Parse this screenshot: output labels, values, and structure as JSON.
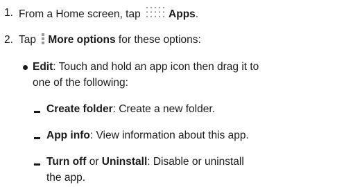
{
  "step1": {
    "number": "1.",
    "text_before": "From a Home screen, tap",
    "icon": "apps-grid-icon",
    "bold": "Apps",
    "text_after": "."
  },
  "step2": {
    "number": "2.",
    "text_before": "Tap",
    "icon": "more-options-vertical-dots-icon",
    "bold": "More options",
    "text_after": " for these options:"
  },
  "edit_item": {
    "bold": "Edit",
    "text_line1": ": Touch and hold an app icon then drag it to",
    "text_line2": "one of the following:"
  },
  "sub_items": [
    {
      "bold": "Create folder",
      "text": ": Create a new folder."
    },
    {
      "bold": "App info",
      "text": ": View information about this app."
    }
  ],
  "turn_off_item": {
    "bold1": "Turn off",
    "mid": " or ",
    "bold2": "Uninstall",
    "text_line1": ": Disable or uninstall",
    "text_line2": "the app."
  },
  "colors": {
    "text": "#1a1a1a",
    "icon": "#9a9a9a"
  }
}
